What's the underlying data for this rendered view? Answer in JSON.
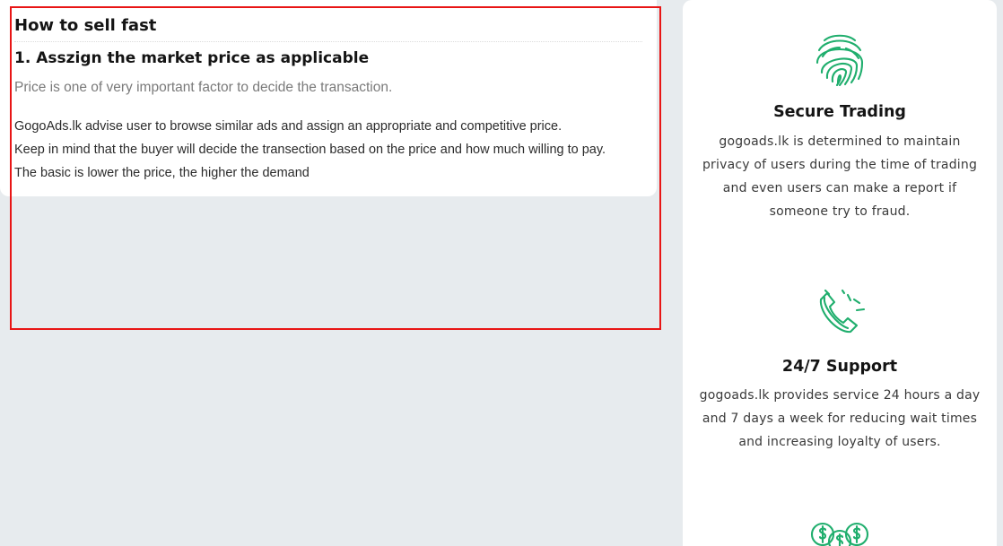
{
  "article": {
    "title": "How to sell fast",
    "subtitle": "1. Asszign the market price as applicable",
    "lead": "Price is one of very important factor to decide the transaction.",
    "body_lines": [
      "GogoAds.lk advise user to browse similar ads and assign an appropriate and competitive price.",
      "Keep in mind that the buyer will decide the transection based on the price and how much willing to pay.",
      "The basic is lower the price, the higher the demand"
    ]
  },
  "features": [
    {
      "icon": "fingerprint-icon",
      "title": "Secure Trading",
      "lines": [
        "gogoads.lk is determined to maintain",
        "privacy of users during the time of trading",
        "and even users can make a report if",
        "someone try to fraud."
      ]
    },
    {
      "icon": "phone-ringing-icon",
      "title": "24/7 Support",
      "lines": [
        "gogoads.lk provides service 24 hours a day",
        "and 7 days a week for reducing wait times",
        "and increasing loyalty of users."
      ]
    },
    {
      "icon": "money-coins-icon"
    }
  ],
  "colors": {
    "page_background": "#e7ebee",
    "card_background": "#ffffff",
    "accent_green": "#1fae6d",
    "highlight_red": "#e81515"
  }
}
